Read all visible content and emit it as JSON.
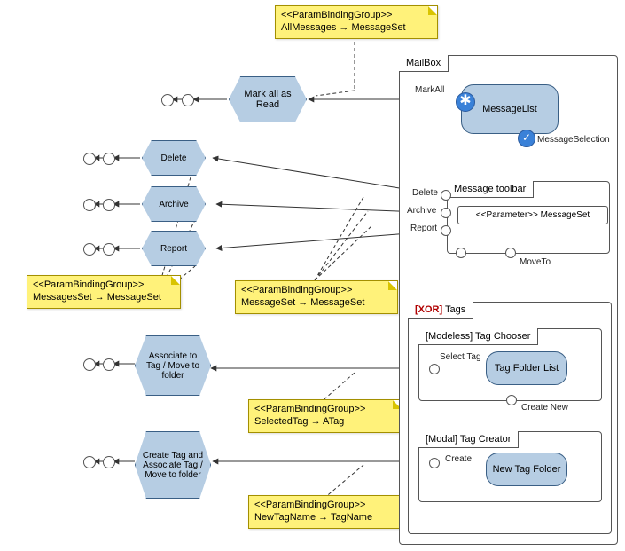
{
  "chart_data": {
    "type": "uml-interaction-diagram",
    "containers": [
      {
        "name": "MailBox",
        "children": [
          "MessageList",
          "Message toolbar",
          "Tags"
        ]
      },
      {
        "name": "Message toolbar",
        "param": "<<Parameter>> MessageSet"
      },
      {
        "name": "[XOR] Tags",
        "children": [
          "[Modeless] Tag Chooser",
          "[Modal] Tag Creator"
        ]
      },
      {
        "name": "[Modeless] Tag Chooser",
        "children": [
          "Tag Folder List"
        ]
      },
      {
        "name": "[Modal] Tag Creator",
        "children": [
          "New Tag Folder"
        ]
      }
    ],
    "actions": [
      "Mark all as Read",
      "Delete",
      "Archive",
      "Report",
      "Associate to Tag / Move to folder",
      "Create Tag and Associate Tag / Move to folder"
    ],
    "events": [
      "MarkAll",
      "MessageSelection",
      "Delete",
      "Archive",
      "Report",
      "MoveTo",
      "Select Tag",
      "Create New",
      "Create"
    ],
    "notes_param_binding": [
      "AllMessages → MessageSet",
      "MessagesSet → MessageSet",
      "MessageSet → MessageSet",
      "SelectedTag → ATag",
      "NewTagName → TagName"
    ]
  },
  "notes": {
    "pb_header": "<<ParamBindingGroup>>",
    "pb1": "AllMessages → MessageSet",
    "pb2": "MessagesSet → MessageSet",
    "pb3": "MessageSet → MessageSet",
    "pb4": "SelectedTag → ATag",
    "pb5": "NewTagName → TagName"
  },
  "frames": {
    "mailbox": "MailBox",
    "toolbar": "Message toolbar",
    "param_box": "<<Parameter>> MessageSet",
    "tags_prefix": "[XOR]",
    "tags": "Tags",
    "chooser": "[Modeless] Tag Chooser",
    "creator": "[Modal] Tag Creator"
  },
  "nodes": {
    "markall": "Mark all as Read",
    "delete": "Delete",
    "archive": "Archive",
    "report": "Report",
    "assoc": "Associate to Tag / Move to folder",
    "createassoc": "Create Tag and Associate Tag / Move to folder",
    "msglist": "MessageList",
    "tagfolder": "Tag Folder List",
    "newtag": "New Tag Folder"
  },
  "labels": {
    "markall_ev": "MarkAll",
    "msgsel": "MessageSelection",
    "delete_ev": "Delete",
    "archive_ev": "Archive",
    "report_ev": "Report",
    "moveto": "MoveTo",
    "selecttag": "Select Tag",
    "createnew": "Create New",
    "create": "Create"
  }
}
